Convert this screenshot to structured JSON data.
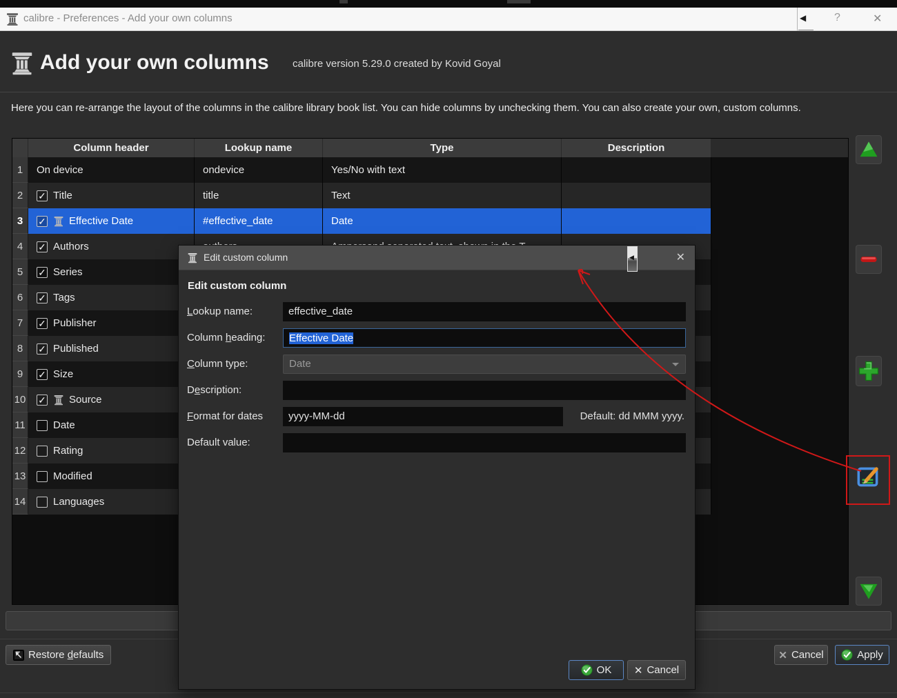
{
  "colors": {
    "selection": "#2263d6",
    "annotation": "#d01818",
    "green": "#2ca52c",
    "red": "#c41616",
    "edit_blue": "#4a8fe0",
    "pencil_orange": "#e8952e"
  },
  "icons": {
    "check": "✓",
    "back": "◀",
    "help": "?",
    "close": "✕",
    "button_x": "✕"
  },
  "titlebar": {
    "app_title": "calibre - Preferences - Add your own columns"
  },
  "header": {
    "title": "Add your own columns",
    "version": "calibre version 5.29.0 created by Kovid Goyal"
  },
  "intro": "Here you can re-arrange the layout of the columns in the calibre library book list. You can hide columns by unchecking them. You can also create your own, custom columns.",
  "table": {
    "columns": [
      "Column header",
      "Lookup name",
      "Type",
      "Description"
    ],
    "rows": [
      {
        "num": "1",
        "check": "none",
        "icon": false,
        "name": "On device",
        "lookup": "ondevice",
        "type": "Yes/No with text",
        "description": "",
        "selected": false
      },
      {
        "num": "2",
        "check": "checked",
        "icon": false,
        "name": "Title",
        "lookup": "title",
        "type": "Text",
        "description": "",
        "selected": false
      },
      {
        "num": "3",
        "check": "checked",
        "icon": true,
        "name": "Effective Date",
        "lookup": "#effective_date",
        "type": "Date",
        "description": "",
        "selected": true
      },
      {
        "num": "4",
        "check": "checked",
        "icon": false,
        "name": "Authors",
        "lookup": "authors",
        "type": "Ampersand separated text, shown in the T",
        "description": "",
        "selected": false
      },
      {
        "num": "5",
        "check": "checked",
        "icon": false,
        "name": "Series",
        "lookup": "",
        "type": "",
        "description": "",
        "selected": false
      },
      {
        "num": "6",
        "check": "checked",
        "icon": false,
        "name": "Tags",
        "lookup": "",
        "type": "",
        "description": "",
        "selected": false
      },
      {
        "num": "7",
        "check": "checked",
        "icon": false,
        "name": "Publisher",
        "lookup": "",
        "type": "",
        "description": "",
        "selected": false
      },
      {
        "num": "8",
        "check": "checked",
        "icon": false,
        "name": "Published",
        "lookup": "",
        "type": "",
        "description": "",
        "selected": false
      },
      {
        "num": "9",
        "check": "checked",
        "icon": false,
        "name": "Size",
        "lookup": "",
        "type": "",
        "description": "",
        "selected": false
      },
      {
        "num": "10",
        "check": "checked",
        "icon": true,
        "name": "Source",
        "lookup": "",
        "type": "",
        "description": "",
        "selected": false
      },
      {
        "num": "11",
        "check": "unchecked",
        "icon": false,
        "name": "Date",
        "lookup": "",
        "type": "",
        "description": "",
        "selected": false
      },
      {
        "num": "12",
        "check": "unchecked",
        "icon": false,
        "name": "Rating",
        "lookup": "",
        "type": "",
        "description": "",
        "selected": false
      },
      {
        "num": "13",
        "check": "unchecked",
        "icon": false,
        "name": "Modified",
        "lookup": "",
        "type": "",
        "description": "",
        "selected": false
      },
      {
        "num": "14",
        "check": "unchecked",
        "icon": false,
        "name": "Languages",
        "lookup": "",
        "type": "",
        "description": "",
        "selected": false
      }
    ]
  },
  "bottom_bar": {
    "restore": {
      "pre": "Restore ",
      "u": "d",
      "post": "efaults"
    },
    "cancel": "Cancel",
    "apply": "Apply"
  },
  "dialog": {
    "title": "Edit custom column",
    "heading": "Edit custom column",
    "fields": {
      "lookup": {
        "label_pre": "",
        "label_u": "L",
        "label_post": "ookup name:",
        "value": "effective_date"
      },
      "heading": {
        "label_pre": "Column ",
        "label_u": "h",
        "label_post": "eading:",
        "value": "Effective Date"
      },
      "type": {
        "label_pre": "",
        "label_u": "C",
        "label_post": "olumn type:",
        "value": "Date"
      },
      "description": {
        "label_pre": "D",
        "label_u": "e",
        "label_post": "scription:",
        "value": ""
      },
      "format": {
        "label_pre": "",
        "label_u": "F",
        "label_post": "ormat for dates",
        "value": "yyyy-MM-dd",
        "hint": "Default: dd MMM yyyy."
      },
      "default_value": {
        "label_pre": "",
        "label_u": "",
        "label_post": "Default value:",
        "value": ""
      }
    },
    "ok": "OK",
    "cancel": "Cancel"
  }
}
